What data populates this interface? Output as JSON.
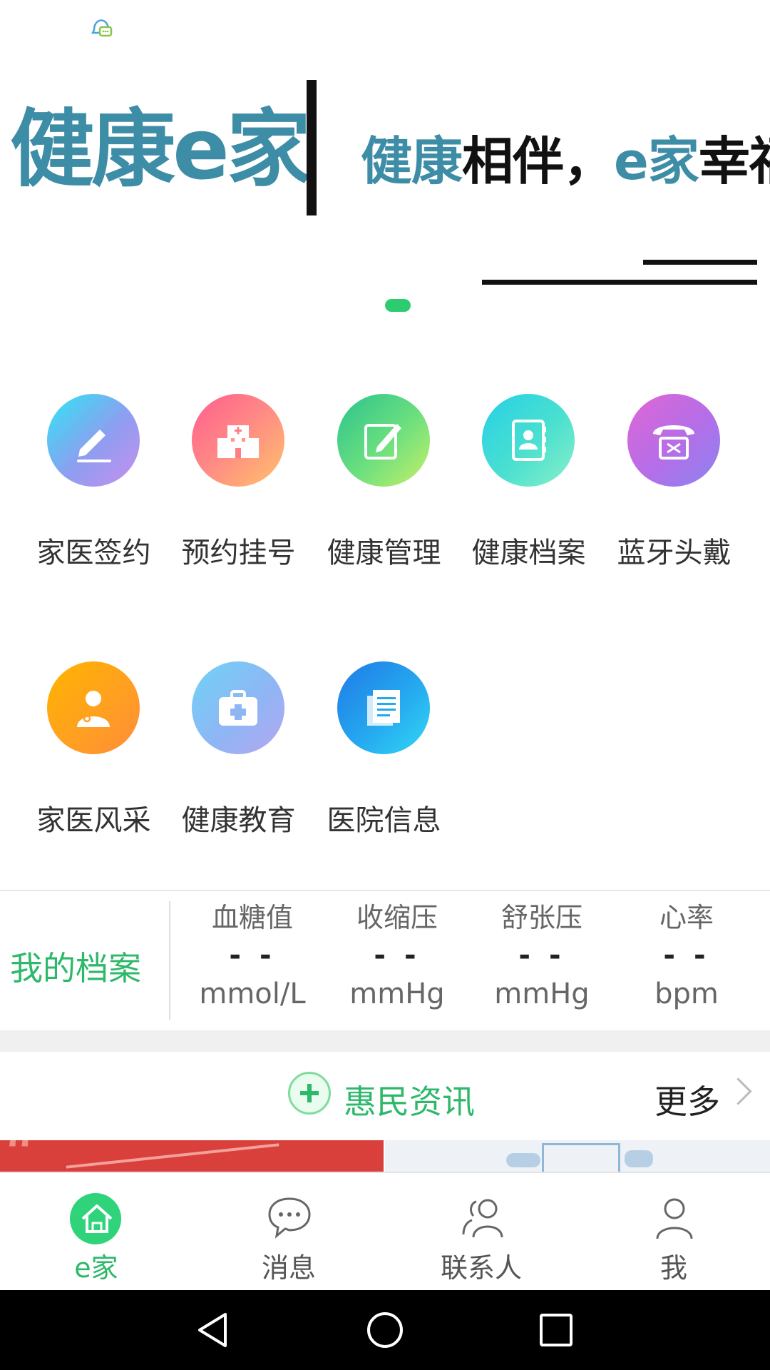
{
  "status_bar": {
    "icon": "chat-bell-icon"
  },
  "banner": {
    "brand": "健康e家",
    "slogan_part1": "健康",
    "slogan_part2": "相伴，",
    "slogan_part3": "e家",
    "slogan_part4": "幸福"
  },
  "menu": {
    "items": [
      {
        "label": "家医签约",
        "icon": "sign-pen-icon"
      },
      {
        "label": "预约挂号",
        "icon": "hospital-icon"
      },
      {
        "label": "健康管理",
        "icon": "edit-note-icon"
      },
      {
        "label": "健康档案",
        "icon": "contact-book-icon"
      },
      {
        "label": "蓝牙头戴",
        "icon": "bluetooth-phone-icon"
      },
      {
        "label": "家医风采",
        "icon": "doctor-icon"
      },
      {
        "label": "健康教育",
        "icon": "first-aid-kit-icon"
      },
      {
        "label": "医院信息",
        "icon": "document-icon"
      }
    ]
  },
  "records": {
    "title": "我的档案",
    "metrics": [
      {
        "name": "血糖值",
        "value": "- -",
        "unit": "mmol/L"
      },
      {
        "name": "收缩压",
        "value": "- -",
        "unit": "mmHg"
      },
      {
        "name": "舒张压",
        "value": "- -",
        "unit": "mmHg"
      },
      {
        "name": "心率",
        "value": "- -",
        "unit": "bpm"
      }
    ]
  },
  "news": {
    "title": "惠民资讯",
    "more": "更多"
  },
  "tabs": [
    {
      "label": "e家",
      "icon": "home-icon",
      "active": true
    },
    {
      "label": "消息",
      "icon": "chat-bubble-icon",
      "active": false
    },
    {
      "label": "联系人",
      "icon": "contacts-icon",
      "active": false
    },
    {
      "label": "我",
      "icon": "person-icon",
      "active": false
    }
  ],
  "colors": {
    "accent": "#2db86a",
    "brand": "#3e8da7"
  }
}
